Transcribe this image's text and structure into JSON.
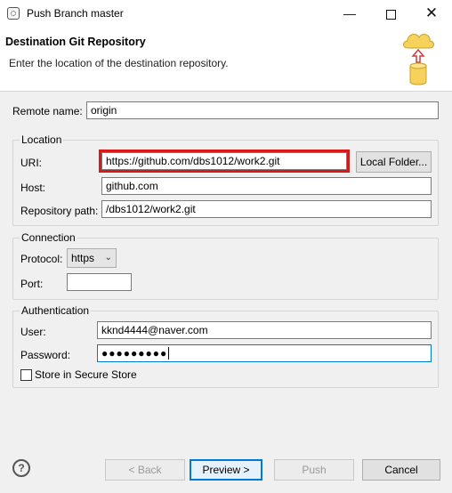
{
  "window": {
    "title": "Push Branch master"
  },
  "header": {
    "title": "Destination Git Repository",
    "description": "Enter the location of the destination repository."
  },
  "remote": {
    "label": "Remote name:",
    "value": "origin"
  },
  "location": {
    "title": "Location",
    "uri_label": "URI:",
    "uri_value": "https://github.com/dbs1012/work2.git",
    "local_folder_button": "Local Folder...",
    "host_label": "Host:",
    "host_value": "github.com",
    "repo_path_label": "Repository path:",
    "repo_path_value": "/dbs1012/work2.git"
  },
  "connection": {
    "title": "Connection",
    "protocol_label": "Protocol:",
    "protocol_value": "https",
    "port_label": "Port:",
    "port_value": ""
  },
  "authentication": {
    "title": "Authentication",
    "user_label": "User:",
    "user_value": "kknd4444@naver.com",
    "password_label": "Password:",
    "password_value": "●●●●●●●●●",
    "store_label": "Store in Secure Store",
    "store_checked": false
  },
  "footer": {
    "back": "< Back",
    "preview": "Preview >",
    "push": "Push",
    "cancel": "Cancel",
    "help_icon": "?"
  },
  "colors": {
    "highlight": "#d61a1a",
    "focus": "#0078d7"
  }
}
